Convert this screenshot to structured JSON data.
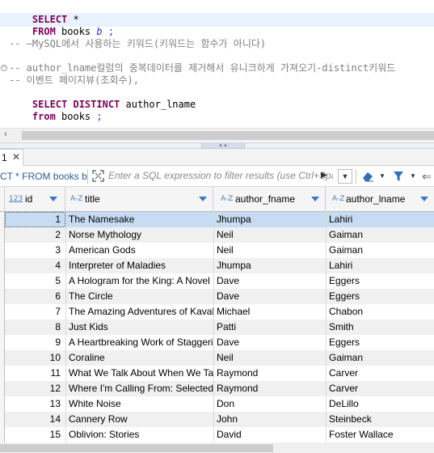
{
  "editor": {
    "line1": {
      "kw": "SELECT",
      "rest": " *"
    },
    "line2": {
      "kw": "FROM",
      "table": " books ",
      "alias": "b",
      "semi": " ;"
    },
    "comment1": "-- —MySQL에서 사용하는 키워드(키워드는 함수가 아니다)",
    "comment2": "-- author_lname컬럼의 중복데이터를 제거해서 유니크하게 가져오기-distinct키워드",
    "comment3": "-- 이벤트 페이지뷰(조회수),",
    "line6": {
      "kw": "SELECT DISTINCT",
      "rest": " author_lname"
    },
    "line7": {
      "kw": "from",
      "table": " books ",
      "semi": ";"
    }
  },
  "result_tab": {
    "label": "1",
    "close": "✕"
  },
  "toolbar": {
    "query_text": "CT * FROM books b",
    "filter_placeholder": "Enter a SQL expression to filter results (use Ctrl+Space)"
  },
  "columns": [
    {
      "type": "123",
      "name": "id"
    },
    {
      "type": "A-Z",
      "name": "title"
    },
    {
      "type": "A-Z",
      "name": "author_fname"
    },
    {
      "type": "A-Z",
      "name": "author_lname"
    }
  ],
  "rows": [
    {
      "id": "1",
      "title": "The Namesake",
      "fname": "Jhumpa",
      "lname": "Lahiri"
    },
    {
      "id": "2",
      "title": "Norse Mythology",
      "fname": "Neil",
      "lname": "Gaiman"
    },
    {
      "id": "3",
      "title": "American Gods",
      "fname": "Neil",
      "lname": "Gaiman"
    },
    {
      "id": "4",
      "title": "Interpreter of Maladies",
      "fname": "Jhumpa",
      "lname": "Lahiri"
    },
    {
      "id": "5",
      "title": "A Hologram for the King: A Novel",
      "fname": "Dave",
      "lname": "Eggers"
    },
    {
      "id": "6",
      "title": "The Circle",
      "fname": "Dave",
      "lname": "Eggers"
    },
    {
      "id": "7",
      "title": "The Amazing Adventures of Kavalier & Clay",
      "fname": "Michael",
      "lname": "Chabon"
    },
    {
      "id": "8",
      "title": "Just Kids",
      "fname": "Patti",
      "lname": "Smith"
    },
    {
      "id": "9",
      "title": "A Heartbreaking Work of Staggering Genius",
      "fname": "Dave",
      "lname": "Eggers"
    },
    {
      "id": "10",
      "title": "Coraline",
      "fname": "Neil",
      "lname": "Gaiman"
    },
    {
      "id": "11",
      "title": "What We Talk About When We Talk About Love",
      "fname": "Raymond",
      "lname": "Carver"
    },
    {
      "id": "12",
      "title": "Where I'm Calling From: Selected Stories",
      "fname": "Raymond",
      "lname": "Carver"
    },
    {
      "id": "13",
      "title": "White Noise",
      "fname": "Don",
      "lname": "DeLillo"
    },
    {
      "id": "14",
      "title": "Cannery Row",
      "fname": "John",
      "lname": "Steinbeck"
    },
    {
      "id": "15",
      "title": "Oblivion: Stories",
      "fname": "David",
      "lname": "Foster Wallace"
    }
  ],
  "colors": {
    "keyword": "#7f0055",
    "alias": "#2a2aff",
    "comment": "#808080",
    "selection": "#c7dcf2"
  }
}
